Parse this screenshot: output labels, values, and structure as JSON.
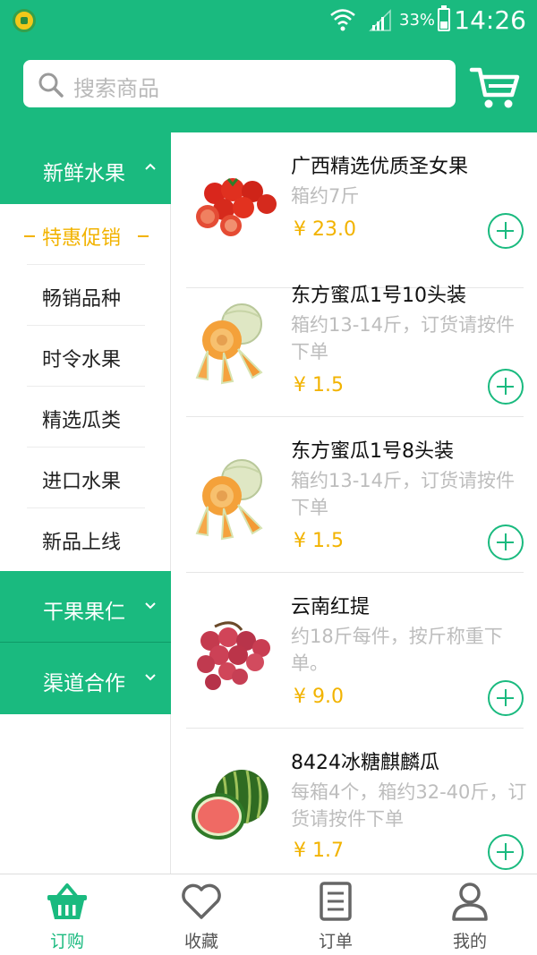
{
  "status_bar": {
    "battery": "33%",
    "time": "14:26"
  },
  "header": {
    "search_placeholder": "搜索商品"
  },
  "sidebar": {
    "categories": [
      {
        "label": "新鲜水果",
        "expanded": true
      },
      {
        "label": "干果果仁",
        "expanded": false
      },
      {
        "label": "渠道合作",
        "expanded": false
      }
    ],
    "subcategories": [
      {
        "label": "特惠促销",
        "active": true
      },
      {
        "label": "畅销品种"
      },
      {
        "label": "时令水果"
      },
      {
        "label": "精选瓜类"
      },
      {
        "label": "进口水果"
      },
      {
        "label": "新品上线"
      }
    ]
  },
  "products": [
    {
      "name": "广西精选优质圣女果",
      "desc": "箱约7斤",
      "price": "¥ 23.0",
      "image": "cherry-tomato"
    },
    {
      "name": "东方蜜瓜1号10头装",
      "desc": "箱约13-14斤，订货请按件下单",
      "price": "¥ 1.5",
      "image": "cantaloupe"
    },
    {
      "name": "东方蜜瓜1号8头装",
      "desc": "箱约13-14斤，订货请按件下单",
      "price": "¥ 1.5",
      "image": "cantaloupe"
    },
    {
      "name": "云南红提",
      "desc": "约18斤每件，按斤称重下单。",
      "price": "¥ 9.0",
      "image": "red-grape"
    },
    {
      "name": "8424冰糖麒麟瓜",
      "desc": "每箱4个，箱约32-40斤，订货请按件下单",
      "price": "¥ 1.7",
      "image": "watermelon"
    }
  ],
  "tabbar": {
    "tabs": [
      {
        "label": "订购",
        "icon": "basket-icon",
        "active": true
      },
      {
        "label": "收藏",
        "icon": "heart-icon"
      },
      {
        "label": "订单",
        "icon": "document-icon"
      },
      {
        "label": "我的",
        "icon": "user-icon"
      }
    ]
  },
  "colors": {
    "primary": "#1aba7f",
    "price": "#f2b300",
    "muted": "#bdbdbd"
  }
}
